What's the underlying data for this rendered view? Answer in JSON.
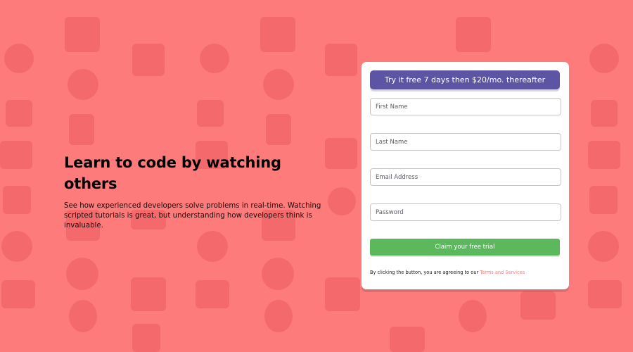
{
  "colors": {
    "background": "#fd7b7b",
    "banner": "#5e54a4",
    "button": "#5cb85c",
    "link": "#ff7a7a",
    "card": "#ffffff"
  },
  "hero": {
    "title": "Learn to code by watching others",
    "description": "See how experienced developers solve problems in real-time. Watching scripted tutorials is great, but understanding how developers think is invaluable."
  },
  "form": {
    "banner_text": "Try it free 7 days then $20/mo. thereafter",
    "fields": {
      "first_name": {
        "placeholder": "First Name",
        "value": ""
      },
      "last_name": {
        "placeholder": "Last Name",
        "value": ""
      },
      "email": {
        "placeholder": "Email Address",
        "value": ""
      },
      "password": {
        "placeholder": "Password",
        "value": ""
      }
    },
    "submit_label": "Claim your free trial",
    "terms_text": "By clicking the button, you are agreeing to our",
    "terms_link": "Terms and Services"
  }
}
